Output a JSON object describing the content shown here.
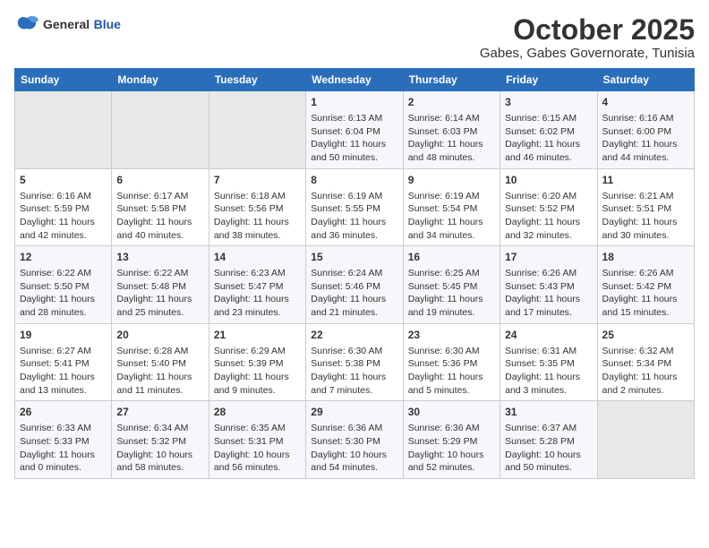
{
  "header": {
    "logo_general": "General",
    "logo_blue": "Blue",
    "title": "October 2025",
    "subtitle": "Gabes, Gabes Governorate, Tunisia"
  },
  "days_of_week": [
    "Sunday",
    "Monday",
    "Tuesday",
    "Wednesday",
    "Thursday",
    "Friday",
    "Saturday"
  ],
  "weeks": [
    [
      {
        "day": "",
        "empty": true
      },
      {
        "day": "",
        "empty": true
      },
      {
        "day": "",
        "empty": true
      },
      {
        "day": "1",
        "sunrise": "6:13 AM",
        "sunset": "6:04 PM",
        "daylight": "11 hours and 50 minutes."
      },
      {
        "day": "2",
        "sunrise": "6:14 AM",
        "sunset": "6:03 PM",
        "daylight": "11 hours and 48 minutes."
      },
      {
        "day": "3",
        "sunrise": "6:15 AM",
        "sunset": "6:02 PM",
        "daylight": "11 hours and 46 minutes."
      },
      {
        "day": "4",
        "sunrise": "6:16 AM",
        "sunset": "6:00 PM",
        "daylight": "11 hours and 44 minutes."
      }
    ],
    [
      {
        "day": "5",
        "sunrise": "6:16 AM",
        "sunset": "5:59 PM",
        "daylight": "11 hours and 42 minutes."
      },
      {
        "day": "6",
        "sunrise": "6:17 AM",
        "sunset": "5:58 PM",
        "daylight": "11 hours and 40 minutes."
      },
      {
        "day": "7",
        "sunrise": "6:18 AM",
        "sunset": "5:56 PM",
        "daylight": "11 hours and 38 minutes."
      },
      {
        "day": "8",
        "sunrise": "6:19 AM",
        "sunset": "5:55 PM",
        "daylight": "11 hours and 36 minutes."
      },
      {
        "day": "9",
        "sunrise": "6:19 AM",
        "sunset": "5:54 PM",
        "daylight": "11 hours and 34 minutes."
      },
      {
        "day": "10",
        "sunrise": "6:20 AM",
        "sunset": "5:52 PM",
        "daylight": "11 hours and 32 minutes."
      },
      {
        "day": "11",
        "sunrise": "6:21 AM",
        "sunset": "5:51 PM",
        "daylight": "11 hours and 30 minutes."
      }
    ],
    [
      {
        "day": "12",
        "sunrise": "6:22 AM",
        "sunset": "5:50 PM",
        "daylight": "11 hours and 28 minutes."
      },
      {
        "day": "13",
        "sunrise": "6:22 AM",
        "sunset": "5:48 PM",
        "daylight": "11 hours and 25 minutes."
      },
      {
        "day": "14",
        "sunrise": "6:23 AM",
        "sunset": "5:47 PM",
        "daylight": "11 hours and 23 minutes."
      },
      {
        "day": "15",
        "sunrise": "6:24 AM",
        "sunset": "5:46 PM",
        "daylight": "11 hours and 21 minutes."
      },
      {
        "day": "16",
        "sunrise": "6:25 AM",
        "sunset": "5:45 PM",
        "daylight": "11 hours and 19 minutes."
      },
      {
        "day": "17",
        "sunrise": "6:26 AM",
        "sunset": "5:43 PM",
        "daylight": "11 hours and 17 minutes."
      },
      {
        "day": "18",
        "sunrise": "6:26 AM",
        "sunset": "5:42 PM",
        "daylight": "11 hours and 15 minutes."
      }
    ],
    [
      {
        "day": "19",
        "sunrise": "6:27 AM",
        "sunset": "5:41 PM",
        "daylight": "11 hours and 13 minutes."
      },
      {
        "day": "20",
        "sunrise": "6:28 AM",
        "sunset": "5:40 PM",
        "daylight": "11 hours and 11 minutes."
      },
      {
        "day": "21",
        "sunrise": "6:29 AM",
        "sunset": "5:39 PM",
        "daylight": "11 hours and 9 minutes."
      },
      {
        "day": "22",
        "sunrise": "6:30 AM",
        "sunset": "5:38 PM",
        "daylight": "11 hours and 7 minutes."
      },
      {
        "day": "23",
        "sunrise": "6:30 AM",
        "sunset": "5:36 PM",
        "daylight": "11 hours and 5 minutes."
      },
      {
        "day": "24",
        "sunrise": "6:31 AM",
        "sunset": "5:35 PM",
        "daylight": "11 hours and 3 minutes."
      },
      {
        "day": "25",
        "sunrise": "6:32 AM",
        "sunset": "5:34 PM",
        "daylight": "11 hours and 2 minutes."
      }
    ],
    [
      {
        "day": "26",
        "sunrise": "6:33 AM",
        "sunset": "5:33 PM",
        "daylight": "11 hours and 0 minutes."
      },
      {
        "day": "27",
        "sunrise": "6:34 AM",
        "sunset": "5:32 PM",
        "daylight": "10 hours and 58 minutes."
      },
      {
        "day": "28",
        "sunrise": "6:35 AM",
        "sunset": "5:31 PM",
        "daylight": "10 hours and 56 minutes."
      },
      {
        "day": "29",
        "sunrise": "6:36 AM",
        "sunset": "5:30 PM",
        "daylight": "10 hours and 54 minutes."
      },
      {
        "day": "30",
        "sunrise": "6:36 AM",
        "sunset": "5:29 PM",
        "daylight": "10 hours and 52 minutes."
      },
      {
        "day": "31",
        "sunrise": "6:37 AM",
        "sunset": "5:28 PM",
        "daylight": "10 hours and 50 minutes."
      },
      {
        "day": "",
        "empty": true
      }
    ]
  ]
}
